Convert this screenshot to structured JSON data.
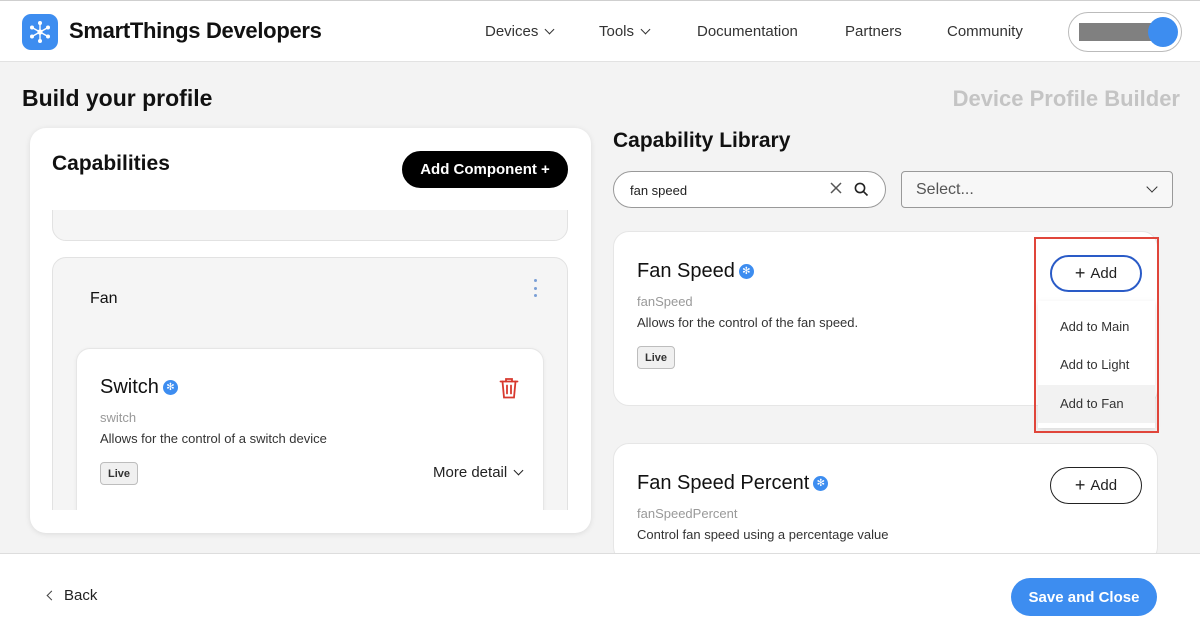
{
  "header": {
    "brand": "SmartThings Developers",
    "logo_icon": "smartthings-logo-icon",
    "nav": [
      {
        "label": "Devices",
        "has_dropdown": true
      },
      {
        "label": "Tools",
        "has_dropdown": true
      },
      {
        "label": "Documentation",
        "has_dropdown": false
      },
      {
        "label": "Partners",
        "has_dropdown": false
      },
      {
        "label": "Community",
        "has_dropdown": false
      }
    ],
    "account_icon": "user-avatar-icon"
  },
  "page": {
    "title": "Build your profile",
    "subtitle": "Device Profile Builder"
  },
  "capabilities_panel": {
    "title": "Capabilities",
    "add_component_label": "Add Component +",
    "component": {
      "name": "Fan",
      "capability": {
        "name": "Switch",
        "id": "switch",
        "description": "Allows for the control of a switch device",
        "status": "Live",
        "more_detail_label": "More detail"
      }
    }
  },
  "library": {
    "title": "Capability Library",
    "search": {
      "value": "fan speed",
      "placeholder": "Search"
    },
    "filter": {
      "value": "Select..."
    },
    "results": [
      {
        "name": "Fan Speed",
        "id": "fanSpeed",
        "description": "Allows for the control of the fan speed.",
        "status": "Live",
        "add_label": "Add"
      },
      {
        "name": "Fan Speed Percent",
        "id": "fanSpeedPercent",
        "description": "Control fan speed using a percentage value",
        "add_label": "Add"
      }
    ],
    "add_menu": [
      "Add to Main",
      "Add to Light",
      "Add to Fan"
    ]
  },
  "footer": {
    "back_label": "Back",
    "save_label": "Save and Close"
  },
  "colors": {
    "accent": "#3d8df0",
    "highlight": "#e0453a",
    "trash": "#d8392e"
  }
}
